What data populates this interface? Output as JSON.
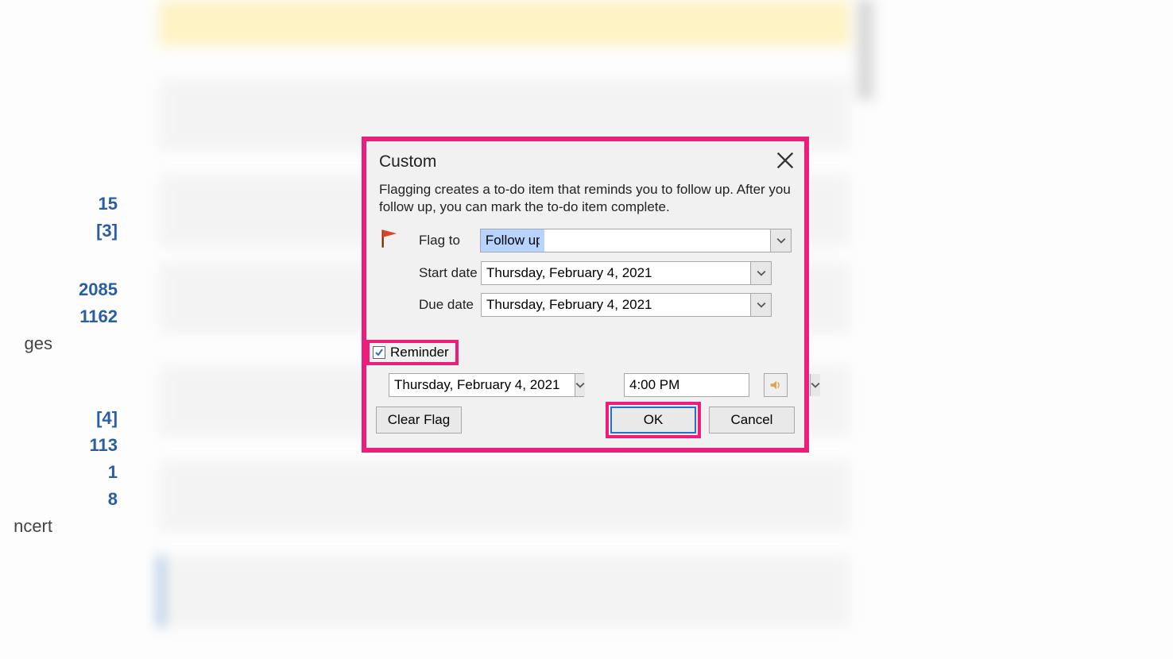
{
  "dialog": {
    "title": "Custom",
    "description": "Flagging creates a to-do item that reminds you to follow up. After you follow up, you can mark the to-do item complete.",
    "flag_to_label": "Flag to",
    "flag_to_value": "Follow up",
    "start_date_label": "Start date",
    "start_date_value": "Thursday, February 4, 2021",
    "due_date_label": "Due date",
    "due_date_value": "Thursday, February 4, 2021",
    "reminder_label": "Reminder",
    "reminder_checked": true,
    "reminder_date": "Thursday, February 4, 2021",
    "reminder_time": "4:00 PM",
    "clear_btn": "Clear Flag",
    "ok_btn": "OK",
    "cancel_btn": "Cancel"
  },
  "left_nav": {
    "n1": "15",
    "n2": "[3]",
    "n3": "2085",
    "n4": "1162",
    "n5": "[4]",
    "n6": "113",
    "n7": "1",
    "n8": "8",
    "lbl1": "ges",
    "lbl2": "ncert"
  }
}
